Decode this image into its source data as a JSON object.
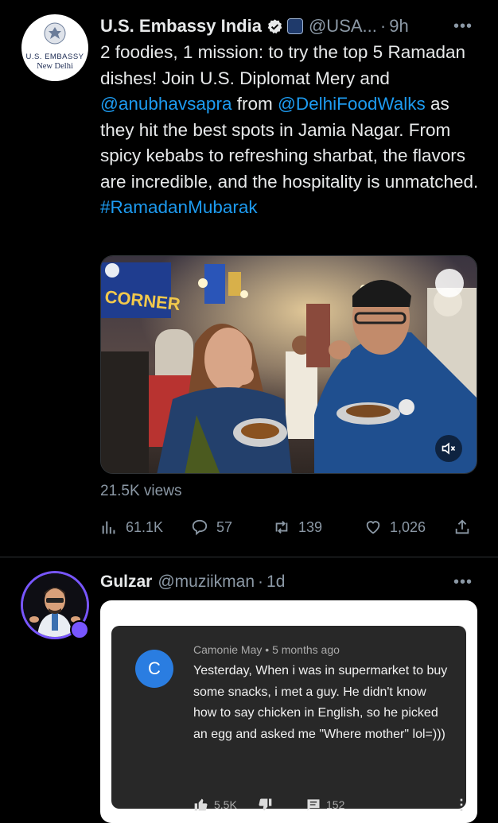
{
  "tweet1": {
    "avatar_line1": "U.S. EMBASSY",
    "avatar_line2": "New Delhi",
    "name": "U.S. Embassy India",
    "handle": "@USA...",
    "separator": "·",
    "time": "9h",
    "text": {
      "part1": "2 foodies, 1 mission: to try the top 5 Ramadan dishes! Join U.S. Diplomat Mery and ",
      "mention1": "@anubhavsapra",
      "part2": " from ",
      "mention2": "@DelhiFoodWalks",
      "part3": " as they hit the best spots in Jamia Nagar. From spicy kebabs to refreshing sharbat, the flavors are incredible, and the hospitality is unmatched. ",
      "hashtag": "#RamadanMubarak"
    },
    "video_sign": "CORNER",
    "views": "21.5K views",
    "stats": {
      "analytics": "61.1K",
      "replies": "57",
      "retweets": "139",
      "likes": "1,026"
    }
  },
  "tweet2": {
    "name": "Gulzar",
    "handle": "@muziikman",
    "separator": "·",
    "time": "1d",
    "comment": {
      "avatar_letter": "C",
      "author": "Camonie May",
      "dot": "•",
      "age": "5 months ago",
      "text": "Yesterday, When i was in supermarket to buy some snacks, i met a guy. He didn't know how to say chicken in English, so he picked an egg and asked me \"Where mother\" lol=)))",
      "likes": "5.5K",
      "replies": "152"
    }
  },
  "colors": {
    "background": "#000000",
    "link": "#1d9bf0",
    "muted": "#8b98a5",
    "verified": "#e7e9ea",
    "avatar_ring": "#7856ff"
  },
  "icons": [
    "seal-icon",
    "verified-icon",
    "affiliate-badge-icon",
    "more-icon",
    "analytics-icon",
    "reply-icon",
    "retweet-icon",
    "like-icon",
    "share-icon",
    "mute-icon",
    "thumbs-up-icon",
    "thumbs-down-icon",
    "comment-icon",
    "kebab-icon"
  ]
}
